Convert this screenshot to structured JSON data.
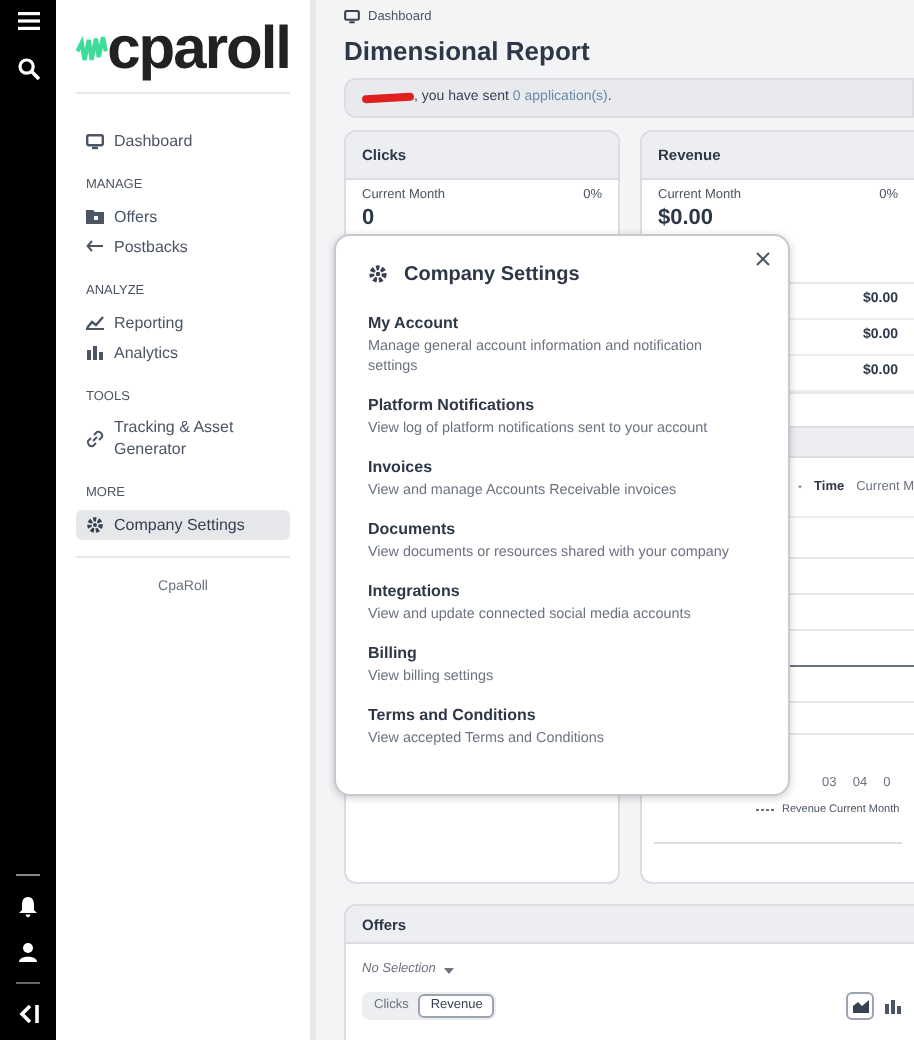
{
  "sidebar": {
    "logo": "cparoll",
    "items": [
      {
        "kind": "link",
        "label": "Dashboard",
        "selected": false
      },
      {
        "kind": "heading",
        "label": "MANAGE"
      },
      {
        "kind": "link",
        "label": "Offers",
        "selected": false
      },
      {
        "kind": "link",
        "label": "Postbacks",
        "selected": false
      },
      {
        "kind": "heading",
        "label": "ANALYZE"
      },
      {
        "kind": "link",
        "label": "Reporting",
        "selected": false
      },
      {
        "kind": "link",
        "label": "Analytics",
        "selected": false
      },
      {
        "kind": "heading",
        "label": "TOOLS"
      },
      {
        "kind": "link",
        "label": "Tracking & Asset Generator",
        "selected": false
      },
      {
        "kind": "heading",
        "label": "MORE"
      },
      {
        "kind": "link",
        "label": "Company Settings",
        "selected": true
      }
    ],
    "footer": "CpaRoll"
  },
  "main": {
    "breadcrumb": "Dashboard",
    "title": "Dimensional Report",
    "notice": {
      "redacted": true,
      "text": ", you have sent",
      "link": "0 application(s)",
      "end": "."
    },
    "clicks_card": {
      "title": "Clicks",
      "period": "Current Month",
      "change": "0%",
      "value": "0"
    },
    "revenue_card": {
      "title": "Revenue",
      "period": "Current Month",
      "change": "0%",
      "value": "$0.00",
      "rows": [
        "$0.00",
        "$0.00",
        "$0.00"
      ],
      "filter": {
        "label": "Time",
        "value": "Current M"
      },
      "x_labels": [
        "03",
        "04",
        "0"
      ],
      "legend": "Revenue Current Month"
    },
    "offers": {
      "title": "Offers",
      "selection": "No Selection",
      "toggle": [
        {
          "label": "Clicks",
          "selected": false
        },
        {
          "label": "Revenue",
          "selected": true
        }
      ],
      "chart_types": [
        {
          "selected": true
        },
        {
          "selected": false
        }
      ]
    }
  },
  "modal": {
    "title": "Company Settings",
    "items": [
      {
        "title": "My Account",
        "description": "Manage general account information and notification settings"
      },
      {
        "title": "Platform Notifications",
        "description": "View log of platform notifications sent to your account"
      },
      {
        "title": "Invoices",
        "description": "View and manage Accounts Receivable invoices"
      },
      {
        "title": "Documents",
        "description": "View documents or resources shared with your company"
      },
      {
        "title": "Integrations",
        "description": "View and update connected social media accounts"
      },
      {
        "title": "Billing",
        "description": "View billing settings"
      },
      {
        "title": "Terms and Conditions",
        "description": "View accepted Terms and Conditions"
      }
    ]
  }
}
